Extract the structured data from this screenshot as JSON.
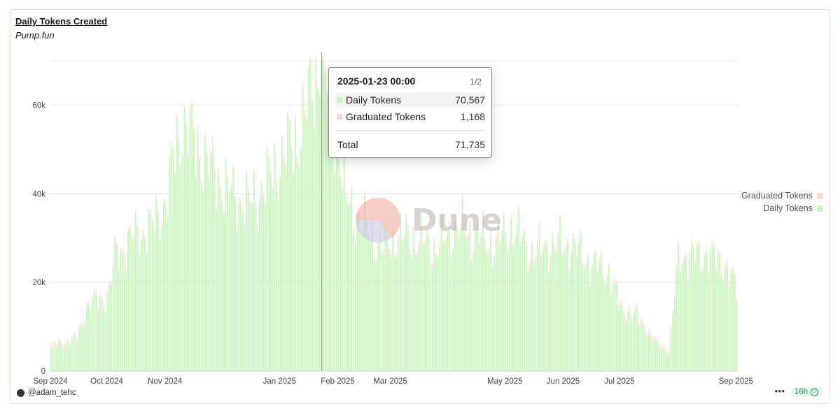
{
  "header": {
    "title": "Daily Tokens Created",
    "subtitle": "Pump.fun"
  },
  "colors": {
    "daily": "#cdf5c2",
    "graduated": "#f7d9cf",
    "grid": "#e6e6e6",
    "axis": "#444444"
  },
  "legend": {
    "graduated_label": "Graduated Tokens",
    "daily_label": "Daily Tokens"
  },
  "tooltip": {
    "date": "2025-01-23 00:00",
    "page": "1/2",
    "rows": [
      {
        "name": "Daily Tokens",
        "value": "70,567"
      },
      {
        "name": "Graduated Tokens",
        "value": "1,168"
      }
    ],
    "total_label": "Total",
    "total_value": "71,735"
  },
  "watermark": {
    "text": "Dune"
  },
  "footer": {
    "author": "@adam_tehc",
    "more_icon": "more-dots-icon",
    "refresh": "16h"
  },
  "chart_data": {
    "type": "bar",
    "stacked": true,
    "x_ticks": [
      "Sep 2024",
      "Oct 2024",
      "Nov 2024",
      "Jan 2025",
      "Feb 2025",
      "Mar 2025",
      "May 2025",
      "Jun 2025",
      "Jul 2025",
      "Sep 2025"
    ],
    "y_ticks": [
      "0",
      "20k",
      "40k",
      "60k"
    ],
    "ylim": [
      0,
      70000
    ],
    "x_start": "2024-09-01",
    "x_end": "2025-09-01",
    "grid": true,
    "legend_position": "right",
    "highlight_date": "2025-01-23",
    "series": [
      {
        "name": "Daily Tokens",
        "keypoints": [
          [
            "2024-09-01",
            5000
          ],
          [
            "2024-09-15",
            7000
          ],
          [
            "2024-09-20",
            14000
          ],
          [
            "2024-09-25",
            15500
          ],
          [
            "2024-10-01",
            16000
          ],
          [
            "2024-10-05",
            25000
          ],
          [
            "2024-10-15",
            30000
          ],
          [
            "2024-10-25",
            32000
          ],
          [
            "2024-11-01",
            38000
          ],
          [
            "2024-11-05",
            47000
          ],
          [
            "2024-11-10",
            56000
          ],
          [
            "2024-11-15",
            52000
          ],
          [
            "2024-11-25",
            45000
          ],
          [
            "2024-12-05",
            40000
          ],
          [
            "2024-12-15",
            37000
          ],
          [
            "2024-12-25",
            42000
          ],
          [
            "2025-01-01",
            47000
          ],
          [
            "2025-01-10",
            52000
          ],
          [
            "2025-01-16",
            60000
          ],
          [
            "2025-01-20",
            67000
          ],
          [
            "2025-01-23",
            70567
          ],
          [
            "2025-01-27",
            60000
          ],
          [
            "2025-02-01",
            50000
          ],
          [
            "2025-02-05",
            38000
          ],
          [
            "2025-02-15",
            32000
          ],
          [
            "2025-02-25",
            27000
          ],
          [
            "2025-03-05",
            30000
          ],
          [
            "2025-03-15",
            29000
          ],
          [
            "2025-03-25",
            27000
          ],
          [
            "2025-04-05",
            32000
          ],
          [
            "2025-04-15",
            30000
          ],
          [
            "2025-04-25",
            28000
          ],
          [
            "2025-05-05",
            32000
          ],
          [
            "2025-05-15",
            26000
          ],
          [
            "2025-05-25",
            28000
          ],
          [
            "2025-06-05",
            28000
          ],
          [
            "2025-06-15",
            24000
          ],
          [
            "2025-06-25",
            22000
          ],
          [
            "2025-07-01",
            14000
          ],
          [
            "2025-07-10",
            12000
          ],
          [
            "2025-07-20",
            6000
          ],
          [
            "2025-07-27",
            4000
          ],
          [
            "2025-08-01",
            25000
          ],
          [
            "2025-08-15",
            26000
          ],
          [
            "2025-08-25",
            24000
          ],
          [
            "2025-09-01",
            18000
          ]
        ]
      },
      {
        "name": "Graduated Tokens",
        "constant": 1000
      }
    ]
  }
}
